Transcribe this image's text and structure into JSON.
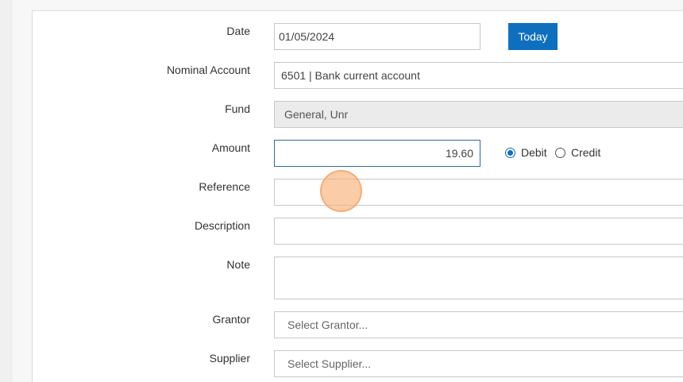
{
  "form": {
    "date": {
      "label": "Date",
      "value": "01/05/2024",
      "today_button": "Today"
    },
    "nominal_account": {
      "label": "Nominal Account",
      "value": "6501 | Bank current account"
    },
    "fund": {
      "label": "Fund",
      "value": "General, Unr"
    },
    "amount": {
      "label": "Amount",
      "value": "19.60",
      "debit_label": "Debit",
      "credit_label": "Credit",
      "selected": "Debit"
    },
    "reference": {
      "label": "Reference",
      "value": ""
    },
    "description": {
      "label": "Description",
      "value": ""
    },
    "note": {
      "label": "Note",
      "value": ""
    },
    "grantor": {
      "label": "Grantor",
      "placeholder": "Select Grantor..."
    },
    "supplier": {
      "label": "Supplier",
      "placeholder": "Select Supplier..."
    }
  },
  "colors": {
    "accent": "#0f6fbf",
    "click_marker": "#f7b078"
  }
}
